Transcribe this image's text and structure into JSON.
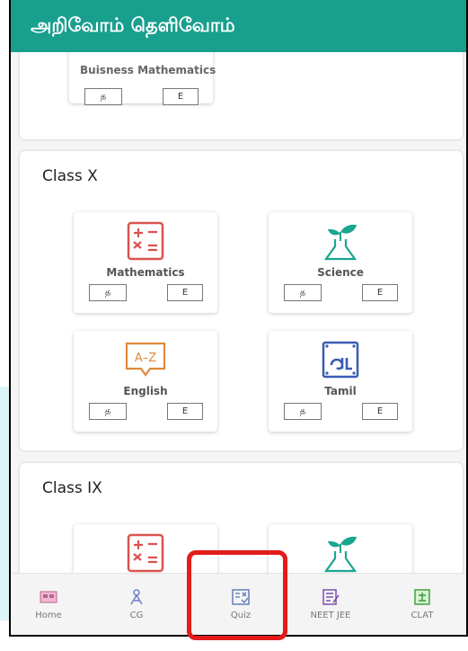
{
  "app": {
    "title": "அறிவோம் தெளிவோம்"
  },
  "top_card": {
    "subject": {
      "name": "Buisness Mathematics",
      "tamil": "த",
      "english": "E"
    }
  },
  "class_x": {
    "title": "Class X",
    "subjects": [
      {
        "name": "Mathematics",
        "icon": "math-book-icon",
        "tamil": "த",
        "english": "E"
      },
      {
        "name": "Science",
        "icon": "plant-flask-icon",
        "tamil": "த",
        "english": "E"
      },
      {
        "name": "English",
        "icon": "a-z-speech-icon",
        "tamil": "த",
        "english": "E"
      },
      {
        "name": "Tamil",
        "icon": "tamil-letter-icon",
        "tamil": "த",
        "english": "E"
      }
    ]
  },
  "class_ix": {
    "title": "Class IX",
    "subjects": [
      {
        "icon": "math-book-icon"
      },
      {
        "icon": "plant-flask-icon"
      }
    ]
  },
  "bottom_nav": {
    "items": [
      {
        "label": "Home",
        "icon": "home-icon"
      },
      {
        "label": "CG",
        "icon": "cg-icon"
      },
      {
        "label": "Quiz",
        "icon": "quiz-icon"
      },
      {
        "label": "NEET JEE",
        "icon": "neet-jee-icon"
      },
      {
        "label": "CLAT",
        "icon": "clat-icon"
      }
    ]
  },
  "colors": {
    "appbar": "#199f8e",
    "math": "#d9534f",
    "science": "#1aa58f",
    "english": "#e08a3c",
    "tamil": "#3b5bb5",
    "highlight": "#e31b1b"
  }
}
